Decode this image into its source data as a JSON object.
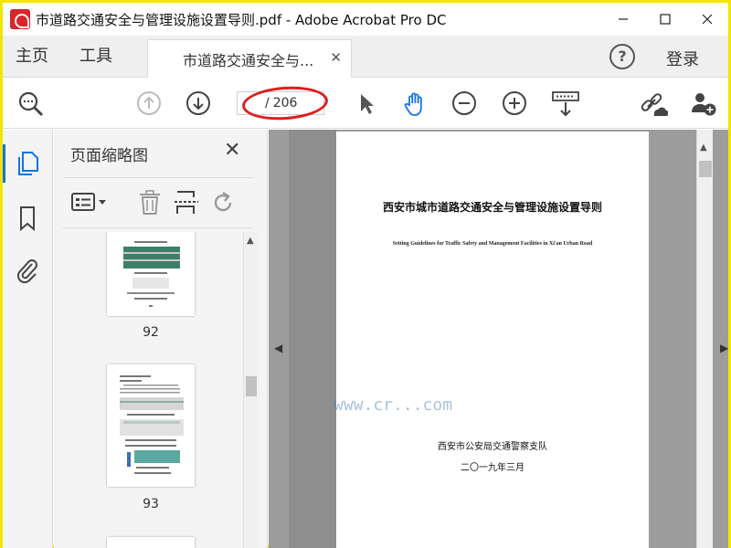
{
  "window": {
    "title": "市道路交通安全与管理设施设置导则.pdf - Adobe Acrobat Pro DC",
    "controls": {
      "minimize": "—",
      "maximize": "☐",
      "close": "✕"
    }
  },
  "tabs": {
    "home": "主页",
    "tools": "工具",
    "document_tab": "市道路交通安全与...",
    "document_tab_close": "✕",
    "help": "?",
    "login": "登录"
  },
  "toolbar": {
    "page_current": "",
    "page_separator": "/",
    "page_total": "206",
    "icons": [
      "search-zoom-icon",
      "page-up-icon",
      "page-down-icon",
      "select-arrow-icon",
      "hand-icon",
      "zoom-out-icon",
      "zoom-in-icon",
      "keyboard-scroll-icon",
      "share-link-icon",
      "add-user-icon"
    ]
  },
  "left_rail": {
    "icons": [
      "page-thumbnails-icon",
      "bookmark-icon",
      "attachment-icon"
    ],
    "accent": "#1473e6"
  },
  "thumbnail_panel": {
    "title": "页面缩略图",
    "close": "✕",
    "tools": [
      "thumbnail-options-icon",
      "delete-page-icon",
      "extract-page-icon",
      "rotate-page-icon"
    ],
    "pages": [
      {
        "label": "92"
      },
      {
        "label": "93"
      }
    ]
  },
  "document": {
    "title_cn": "西安市城市道路交通安全与管理设施设置导则",
    "title_en": "Setting Guidelines for Traffic Safety and Management Facilities in Xi'an Urban Road",
    "organization": "西安市公安局交通警察支队",
    "date": "二〇一九年三月"
  },
  "annotation": {
    "color": "#d8201f"
  },
  "watermark": {
    "text": "www.cr...com"
  }
}
